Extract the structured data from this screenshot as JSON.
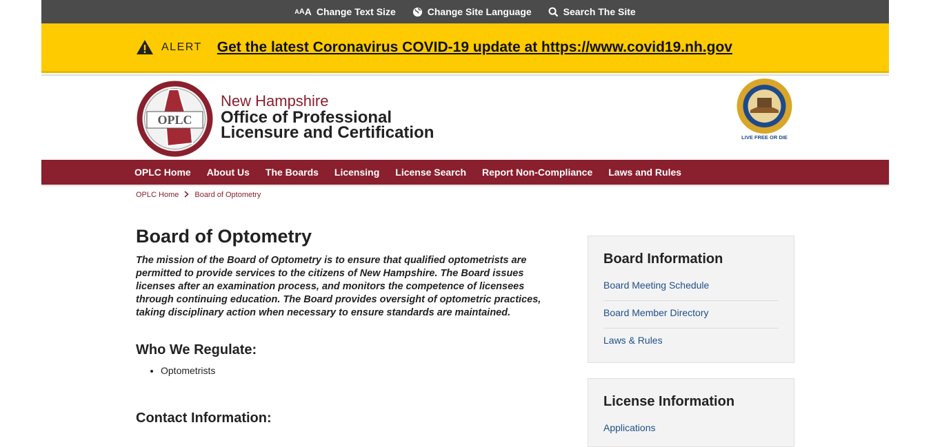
{
  "utility": {
    "text_size_a": [
      "A",
      "A",
      "A"
    ],
    "text_size_label": "Change Text Size",
    "language_label": "Change Site Language",
    "search_label": "Search The Site"
  },
  "alert": {
    "label": "ALERT",
    "link_text": "Get the latest Coronavirus COVID-19 update at https://www.covid19.nh.gov"
  },
  "header": {
    "logo_text": "OPLC",
    "state": "New Hampshire",
    "name_line1": "Office of Professional",
    "name_line2": "Licensure and Certification",
    "seal_motto": "LIVE FREE OR DIE"
  },
  "nav": {
    "items": [
      "OPLC Home",
      "About Us",
      "The Boards",
      "Licensing",
      "License Search",
      "Report Non-Compliance",
      "Laws and Rules"
    ]
  },
  "breadcrumb": {
    "home": "OPLC Home",
    "current": "Board of Optometry"
  },
  "main": {
    "title": "Board of Optometry",
    "mission": "The mission of the Board of Optometry is to ensure that qualified optometrists are permitted to provide services to the citizens of New Hampshire. The Board issues licenses after an examination process, and monitors the competence of licensees through continuing education. The Board provides oversight of optometric practices, taking disciplinary action when necessary to ensure standards are maintained.",
    "who_heading": "Who We Regulate:",
    "regulated": [
      "Optometrists"
    ],
    "contact_heading": "Contact Information:"
  },
  "sidebar": {
    "board_info_title": "Board Information",
    "board_info_links": [
      "Board Meeting Schedule",
      "Board Member Directory",
      "Laws & Rules"
    ],
    "license_info_title": "License Information",
    "license_info_links": [
      "Applications"
    ]
  },
  "colors": {
    "utility_bg": "#4b4b4b",
    "alert_bg": "#fecb00",
    "brand_maroon": "#8a1f2d",
    "link_blue": "#1f4f8a"
  }
}
